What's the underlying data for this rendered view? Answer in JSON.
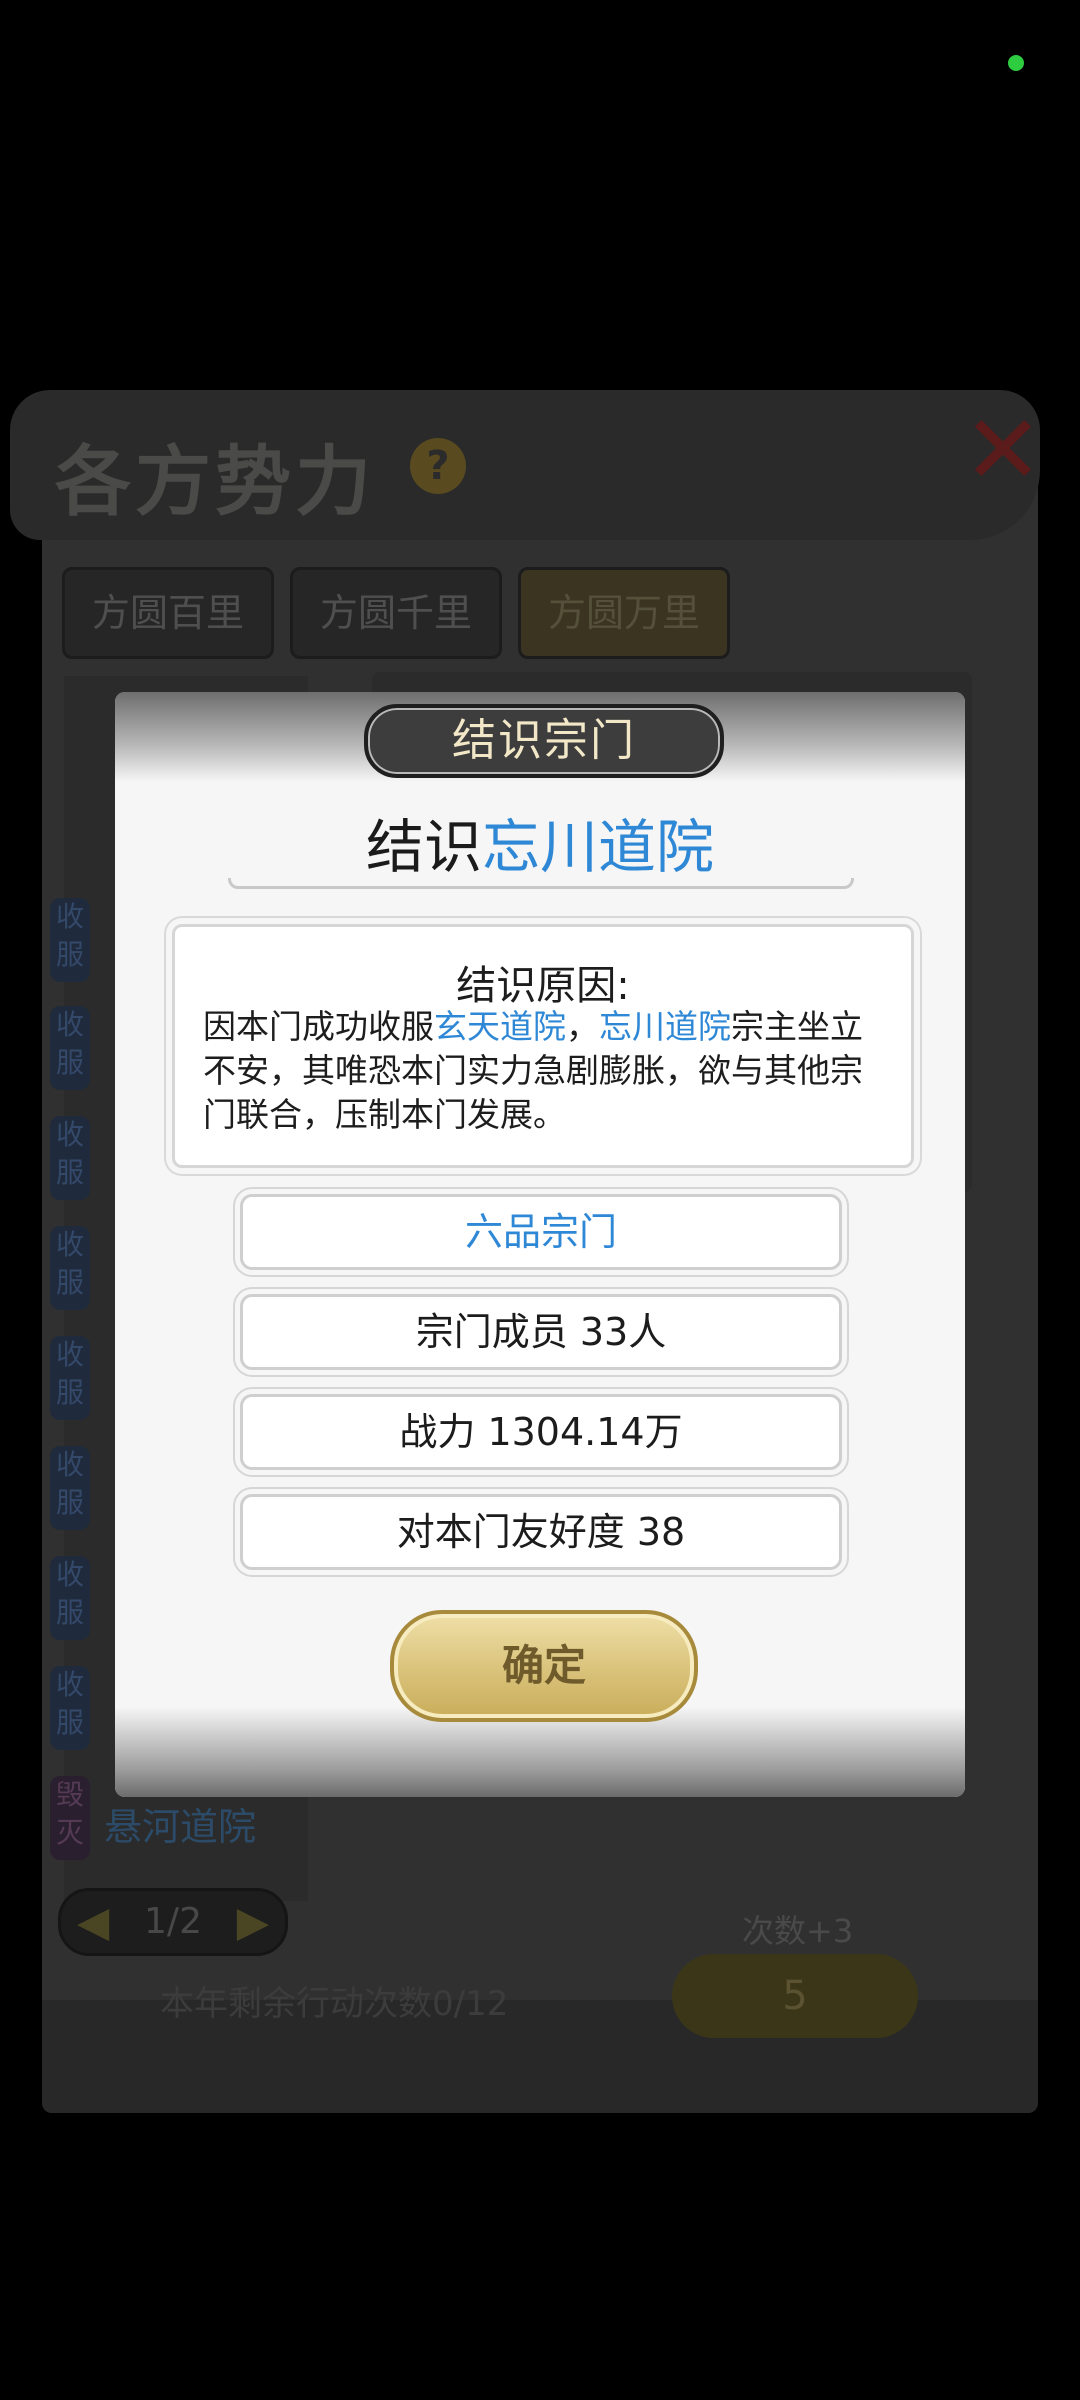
{
  "background": {
    "title": "各方势力",
    "help_glyph": "?",
    "close_glyph": "✕",
    "tabs": [
      "方圆百里",
      "方圆千里",
      "方圆万里"
    ],
    "tags": [
      "收服",
      "收服",
      "收服",
      "收服",
      "收服",
      "收服",
      "收服",
      "收服",
      "毁灭"
    ],
    "last_item": "悬河道院",
    "pager": "1/2",
    "remaining": "本年剩余行动次数0/12",
    "count_label": "次数+3",
    "count_button": "5"
  },
  "dialog": {
    "header": "结识宗门",
    "title_prefix": "结识",
    "title_sect": "忘川道院",
    "reason": {
      "title": "结识原因:",
      "part1": "因本门成功收服",
      "sect_a": "玄天道院",
      "sep": "，",
      "sect_b": "忘川道院",
      "part2": "宗主坐立不安，其唯恐本门实力急剧膨胀，欲与其他宗门联合，压制本门发展。"
    },
    "rank": "六品宗门",
    "members": "宗门成员 33人",
    "power": "战力 1304.14万",
    "friendship": "对本门友好度 38",
    "confirm": "确定"
  },
  "colors": {
    "highlight": "#2f88d6",
    "gold": "#d9c27a",
    "status_dot": "#2ecc40"
  }
}
